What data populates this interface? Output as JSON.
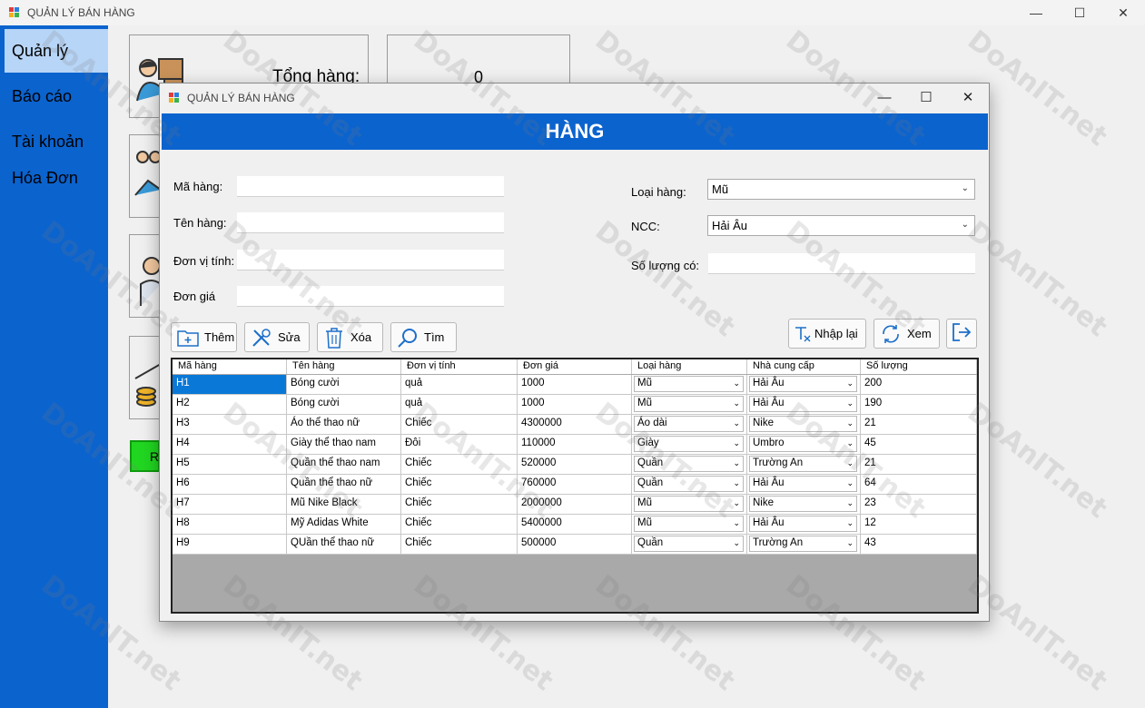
{
  "main_window": {
    "title": "QUẢN LÝ BÁN HÀNG",
    "controls": {
      "minimize": "—",
      "maximize": "☐",
      "close": "✕"
    }
  },
  "sidebar": {
    "items": [
      {
        "label": "Quản lý"
      },
      {
        "label": "Báo cáo"
      },
      {
        "label": "Tài khoản"
      },
      {
        "label": "Hóa Đơn"
      }
    ]
  },
  "dashboard": {
    "total_label": "Tổng hàng:",
    "total_value": "0",
    "green_button_label": "R"
  },
  "dialog": {
    "title": "QUẢN LÝ BÁN HÀNG",
    "controls": {
      "minimize": "—",
      "maximize": "☐",
      "close": "✕"
    },
    "header": "HÀNG",
    "fields": {
      "ma_hang": {
        "label": "Mã hàng:",
        "value": ""
      },
      "ten_hang": {
        "label": "Tên hàng:",
        "value": ""
      },
      "don_vi_tinh": {
        "label": "Đơn vị tính:",
        "value": ""
      },
      "don_gia": {
        "label": "Đơn giá",
        "value": ""
      },
      "loai_hang": {
        "label": "Loại hàng:",
        "value": "Mũ"
      },
      "ncc": {
        "label": "NCC:",
        "value": "Hải Âu"
      },
      "so_luong_co": {
        "label": "Số lượng có:",
        "value": ""
      }
    },
    "buttons": {
      "them": "Thêm",
      "sua": "Sửa",
      "xoa": "Xóa",
      "tim": "Tìm",
      "nhap_lai": "Nhập lại",
      "xem": "Xem"
    },
    "table": {
      "columns": [
        "Mã hàng",
        "Tên hàng",
        "Đơn vị tính",
        "Đơn giá",
        "Loại hàng",
        "Nhà cung cấp",
        "Số lượng"
      ],
      "rows": [
        [
          "H1",
          "Bóng cười",
          "quả",
          "1000",
          "Mũ",
          "Hải Âu",
          "200"
        ],
        [
          "H2",
          "Bóng cười",
          "quả",
          "1000",
          "Mũ",
          "Hải Âu",
          "190"
        ],
        [
          "H3",
          "Áo thể thao nữ",
          "Chiếc",
          "4300000",
          "Áo dài",
          "Nike",
          "21"
        ],
        [
          "H4",
          "Giày thể thao nam",
          "Đôi",
          "110000",
          "Giày",
          "Umbro",
          "45"
        ],
        [
          "H5",
          "Quần thể thao nam",
          "Chiếc",
          "520000",
          "Quần",
          "Trường An",
          "21"
        ],
        [
          "H6",
          "Quần thể thao nữ",
          "Chiếc",
          "760000",
          "Quần",
          "Hải Âu",
          "64"
        ],
        [
          "H7",
          "Mũ Nike Black",
          "Chiếc",
          "2000000",
          "Mũ",
          "Nike",
          "23"
        ],
        [
          "H8",
          "Mỹ Adidas White",
          "Chiếc",
          "5400000",
          "Mũ",
          "Hải Âu",
          "12"
        ],
        [
          "H9",
          "QUần thể thao nữ",
          "Chiếc",
          "500000",
          "Quần",
          "Trường An",
          "43"
        ]
      ]
    }
  },
  "watermark": "DoAnIT.net",
  "colors": {
    "accent": "#0b63ce",
    "selection": "#0a78d7",
    "green": "#21d621"
  }
}
